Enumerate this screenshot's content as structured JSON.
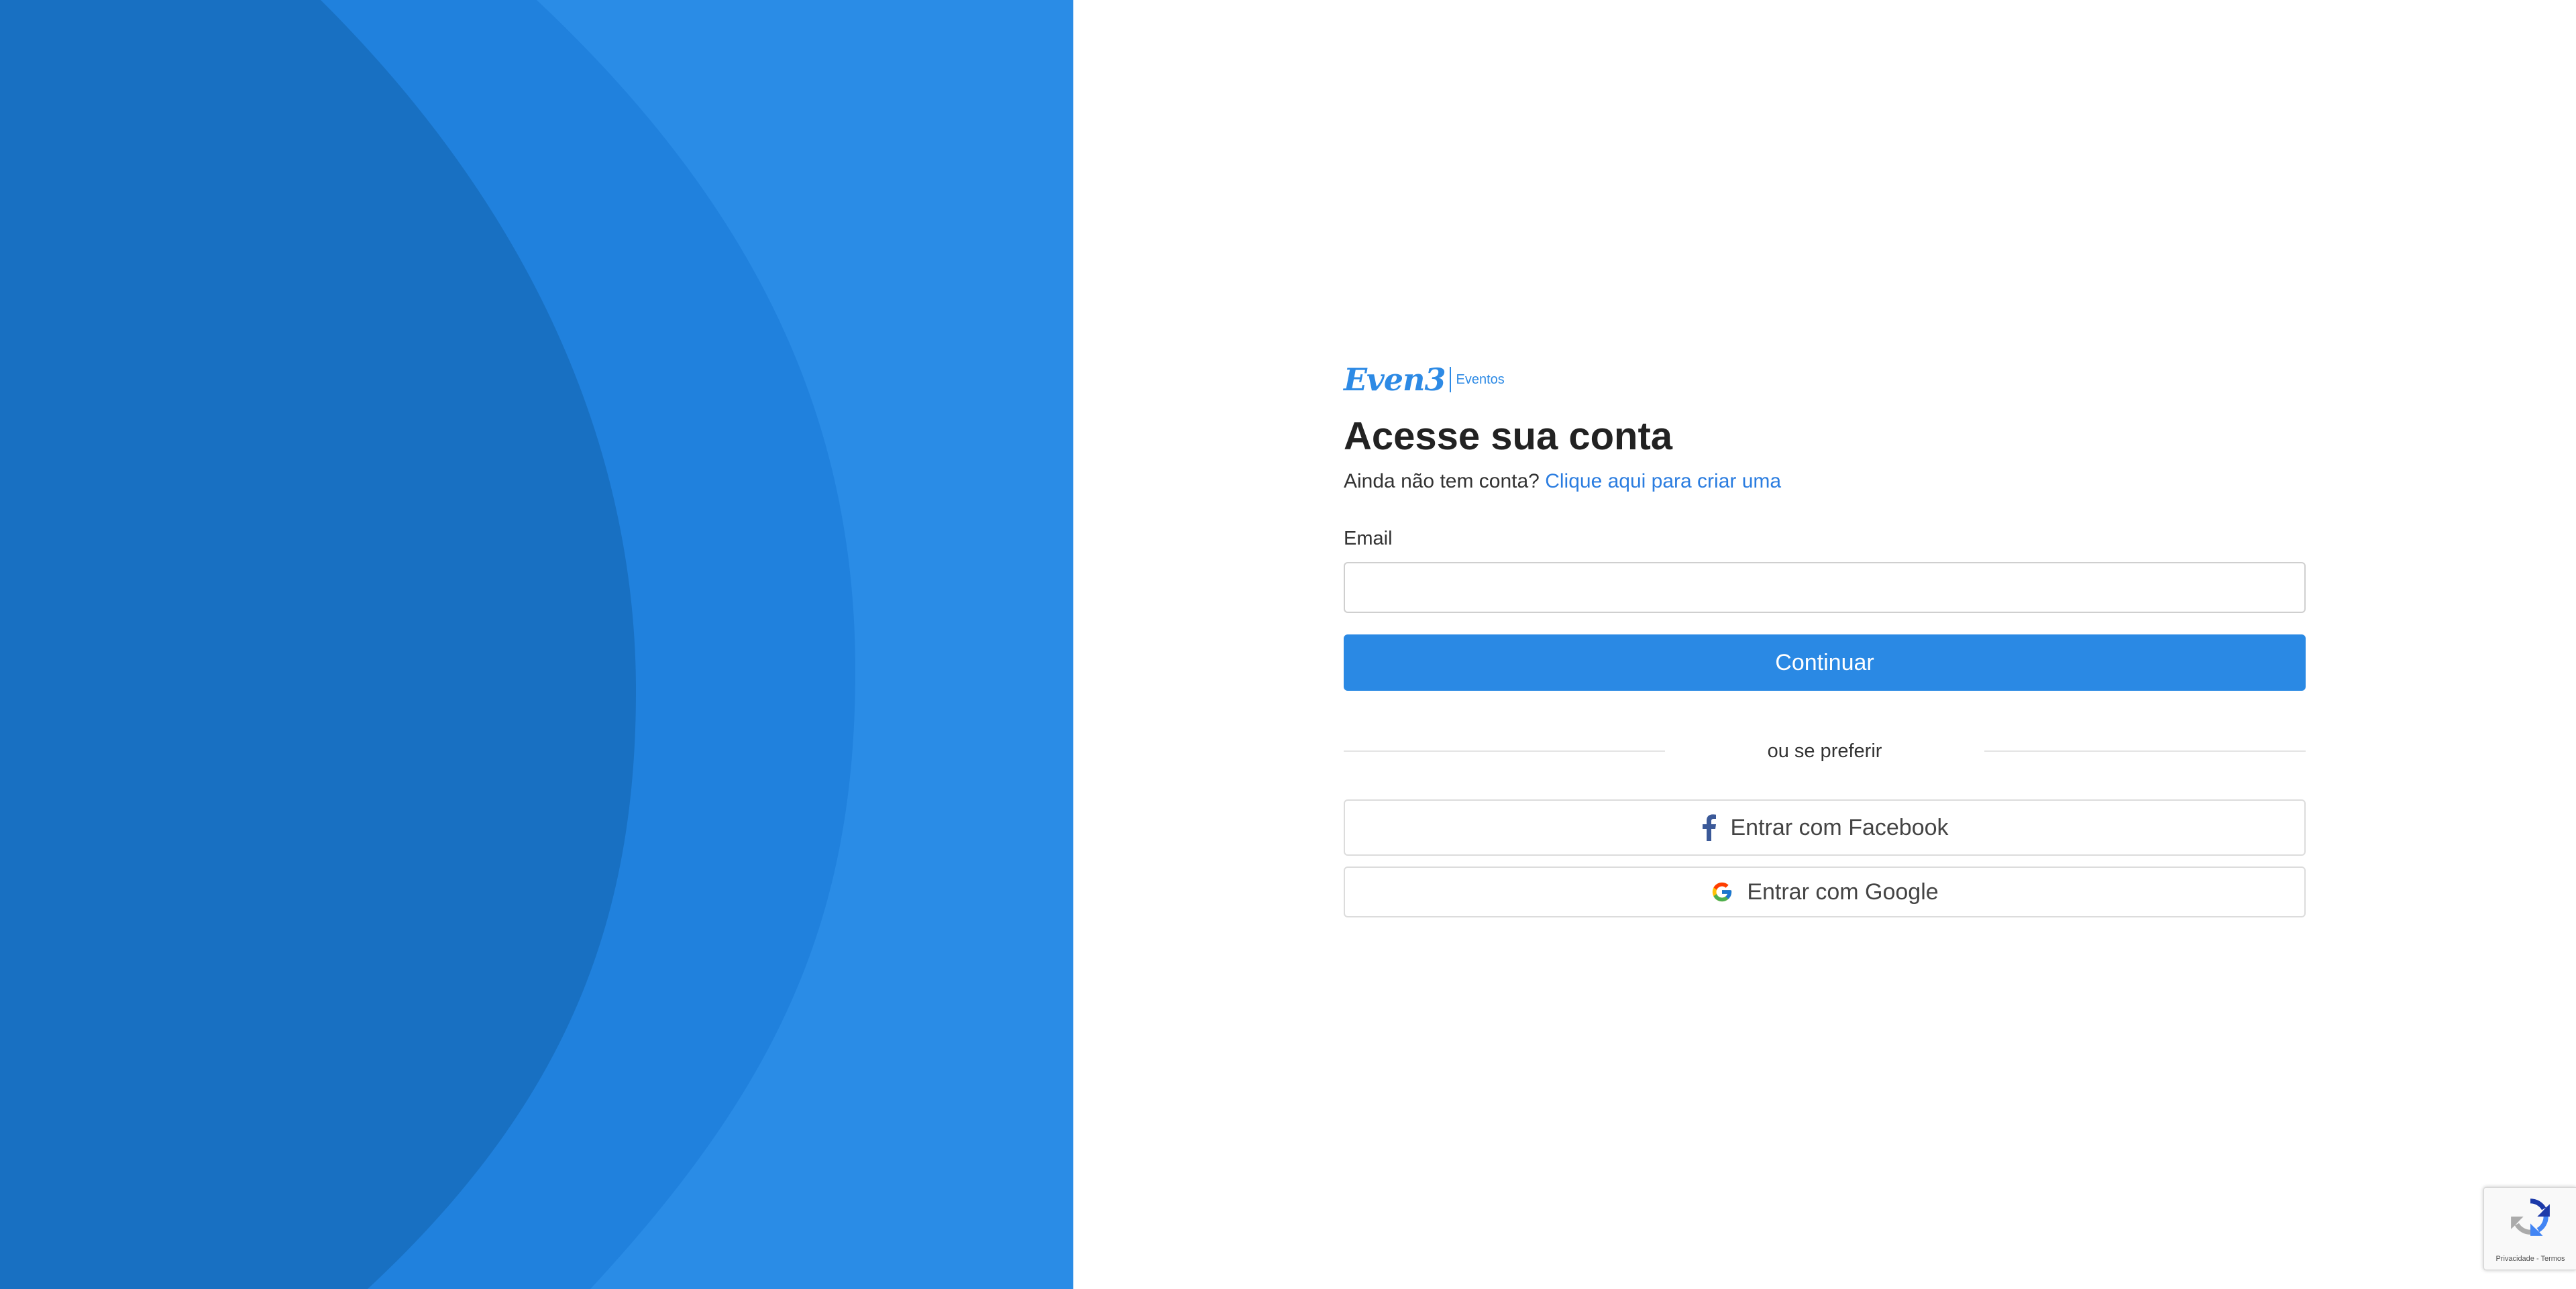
{
  "brand": {
    "name": "Even3",
    "sub": "Eventos",
    "color": "#2d8ae5"
  },
  "login": {
    "title": "Acesse sua conta",
    "signup_prompt": "Ainda não tem conta?",
    "signup_link": "Clique aqui para criar uma",
    "email_label": "Email",
    "email_value": "",
    "email_placeholder": "",
    "continue_label": "Continuar",
    "divider_text": "ou se preferir",
    "facebook_label": "Entrar com Facebook",
    "google_label": "Entrar com Google"
  },
  "recaptcha": {
    "footer": "Privacidade - Termos"
  },
  "colors": {
    "primary_button": "#2a89e4",
    "link": "#2b7de0",
    "hero_dark": "#1870c2",
    "hero_mid": "#2081dd",
    "hero_light": "#2a8ce6",
    "facebook": "#3b5998"
  },
  "icons": {
    "facebook": "facebook-icon",
    "google": "google-icon",
    "recaptcha": "recaptcha-icon"
  }
}
